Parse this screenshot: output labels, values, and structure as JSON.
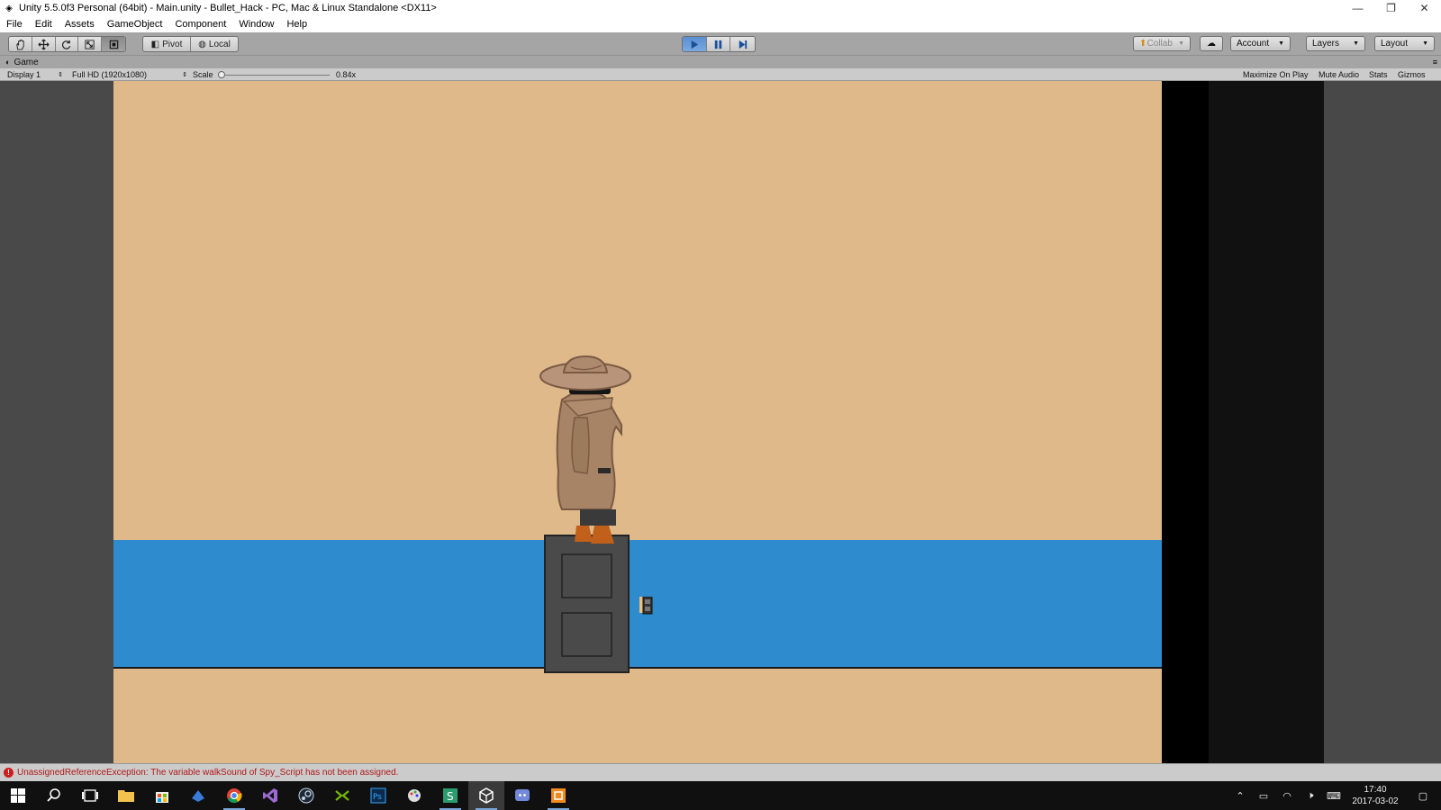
{
  "window": {
    "title": "Unity 5.5.0f3 Personal (64bit) - Main.unity - Bullet_Hack - PC, Mac & Linux Standalone <DX11>"
  },
  "menu": [
    "File",
    "Edit",
    "Assets",
    "GameObject",
    "Component",
    "Window",
    "Help"
  ],
  "toolbar": {
    "pivot_label": "Pivot",
    "local_label": "Local",
    "collab_label": "Collab",
    "account_label": "Account",
    "layers_label": "Layers",
    "layout_label": "Layout"
  },
  "game_view": {
    "tab_label": "Game",
    "display_label": "Display 1",
    "resolution_label": "Full HD (1920x1080)",
    "scale_label": "Scale",
    "scale_value": "0.84x",
    "scale_fraction": 0.0,
    "maximize_label": "Maximize On Play",
    "mute_label": "Mute Audio",
    "stats_label": "Stats",
    "gizmos_label": "Gizmos"
  },
  "colors": {
    "canvas_bg": "#e0b98a",
    "blue_band": "#2e8bcd",
    "play_active": "#5a8fd0"
  },
  "console": {
    "error_message": "UnassignedReferenceException: The variable walkSound of Spy_Script has not been assigned."
  },
  "taskbar": {
    "time": "17:40",
    "date": "2017-03-02",
    "icons": [
      "windows-start-icon",
      "search-icon",
      "task-view-icon",
      "file-explorer-icon",
      "store-icon",
      "app-icon",
      "chrome-icon",
      "visual-studio-icon",
      "steam-icon",
      "xtreme-icon",
      "photoshop-icon",
      "paint-icon",
      "s-app-icon",
      "unity-icon",
      "discord-icon",
      "orange-app-icon"
    ]
  }
}
